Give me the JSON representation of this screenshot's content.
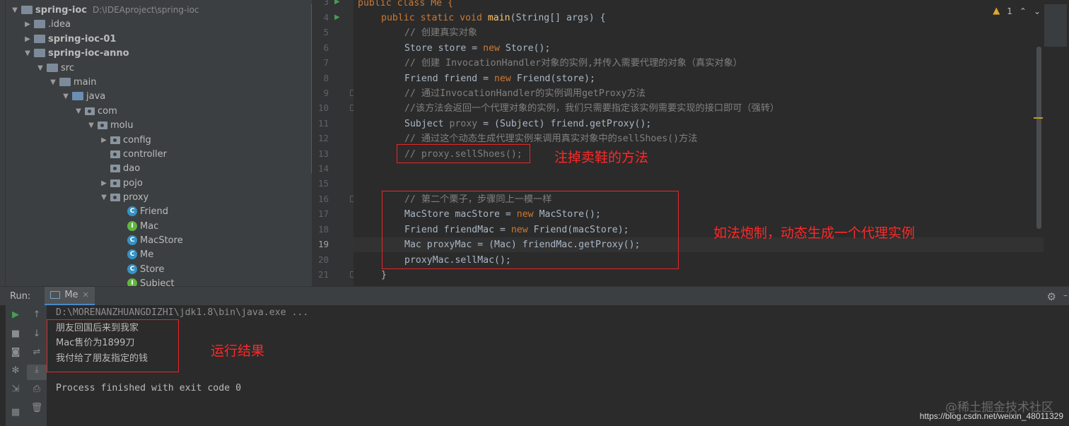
{
  "project": {
    "root_name": "spring-ioc",
    "root_path": "D:\\IDEAproject\\spring-ioc",
    "nodes": [
      {
        "label": ".idea",
        "kind": "folder"
      },
      {
        "label": "spring-ioc-01",
        "kind": "module"
      },
      {
        "label": "spring-ioc-anno",
        "kind": "module"
      },
      {
        "label": "src",
        "kind": "folder"
      },
      {
        "label": "main",
        "kind": "folder"
      },
      {
        "label": "java",
        "kind": "source-root"
      },
      {
        "label": "com",
        "kind": "package"
      },
      {
        "label": "molu",
        "kind": "package"
      },
      {
        "label": "config",
        "kind": "package"
      },
      {
        "label": "controller",
        "kind": "package"
      },
      {
        "label": "dao",
        "kind": "package"
      },
      {
        "label": "pojo",
        "kind": "package"
      },
      {
        "label": "proxy",
        "kind": "package"
      },
      {
        "label": "Friend",
        "kind": "class"
      },
      {
        "label": "Mac",
        "kind": "interface"
      },
      {
        "label": "MacStore",
        "kind": "class"
      },
      {
        "label": "Me",
        "kind": "class"
      },
      {
        "label": "Store",
        "kind": "class"
      },
      {
        "label": "Subject",
        "kind": "interface"
      }
    ]
  },
  "editor": {
    "line_numbers": [
      "3",
      "4",
      "5",
      "6",
      "7",
      "8",
      "9",
      "10",
      "11",
      "12",
      "13",
      "14",
      "15",
      "16",
      "17",
      "18",
      "19",
      "20",
      "21"
    ],
    "current_line": "19",
    "inspection_count": "1",
    "code": {
      "l3": "public class Me {",
      "l4a": "public static void ",
      "l4b": "main",
      "l4c": "(String[] args) {",
      "l5": "// 创建真实对象",
      "l6a": "Store store = ",
      "l6b": "new ",
      "l6c": "Store();",
      "l7": "// 创建 InvocationHandler对象的实例,并传入需要代理的对象（真实对象）",
      "l8a": "Friend friend = ",
      "l8b": "new ",
      "l8c": "Friend(store);",
      "l9": "// 通过InvocationHandler的实例调用getProxy方法",
      "l10": "//该方法会返回一个代理对象的实例，我们只需要指定该实例需要实现的接口即可（强转）",
      "l11a": "Subject ",
      "l11b": "proxy",
      "l11c": " = (Subject) friend.getProxy();",
      "l12": "// 通过这个动态生成代理实例来调用真实对象中的sellShoes()方法",
      "l13": "// proxy.sellShoes();",
      "l16": "// 第二个栗子，步骤同上一模一样",
      "l17a": "MacStore macStore = ",
      "l17b": "new ",
      "l17c": "MacStore();",
      "l18a": "Friend friendMac = ",
      "l18b": "new ",
      "l18c": "Friend(macStore);",
      "l19": "Mac proxyMac = (Mac) friendMac.getProxy();",
      "l20": "proxyMac.sellMac();",
      "l21": "}"
    },
    "annotations": {
      "comment_out": "注掉卖鞋的方法",
      "second_example": "如法炮制，动态生成一个代理实例"
    }
  },
  "run": {
    "label": "Run:",
    "tab": "Me",
    "command": "D:\\MORENANZHUANGDIZHI\\jdk1.8\\bin\\java.exe ...",
    "output": [
      "朋友回国后来到我家",
      "Mac售价为1899刀",
      "我付给了朋友指定的钱"
    ],
    "result_note": "运行结果",
    "exit_line": "Process finished with exit code 0"
  },
  "watermark": {
    "brand": "@稀土掘金技术社区",
    "url": "https://blog.csdn.net/weixin_48011329"
  },
  "colors": {
    "keyword": "#cc7832",
    "method": "#ffc66d",
    "comment": "#808080",
    "field": "#9876aa",
    "annotation_red": "#ff2828"
  }
}
